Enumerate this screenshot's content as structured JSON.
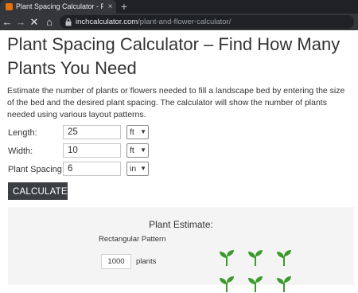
{
  "browser": {
    "tab_title": "Plant Spacing Calculator - Find H",
    "tab_close": "×",
    "new_tab": "+",
    "url_host": "inchcalculator.com",
    "url_path": "/plant-and-flower-calculator/",
    "nav": {
      "back": "←",
      "forward": "→",
      "stop": "✕",
      "home": "⌂"
    }
  },
  "page": {
    "title": "Plant Spacing Calculator – Find How Many Plants You Need",
    "intro": "Estimate the number of plants or flowers needed to fill a landscape bed by entering the size of the bed and the desired plant spacing. The calculator will show the number of plants needed using various layout patterns."
  },
  "form": {
    "length": {
      "label": "Length:",
      "value": "25",
      "unit": "ft"
    },
    "width": {
      "label": "Width:",
      "value": "10",
      "unit": "ft"
    },
    "spacing": {
      "label": "Plant Spacing:",
      "value": "6",
      "unit": "in"
    },
    "calculate_label": "CALCULATE"
  },
  "results": {
    "title": "Plant Estimate:",
    "pattern": "Rectangular Pattern",
    "count": "1000",
    "count_unit": "plants"
  },
  "colors": {
    "plant_green": "#3c9a2c",
    "button_bg": "#3c3f41"
  },
  "icons": {
    "plant": "sprout-icon"
  }
}
